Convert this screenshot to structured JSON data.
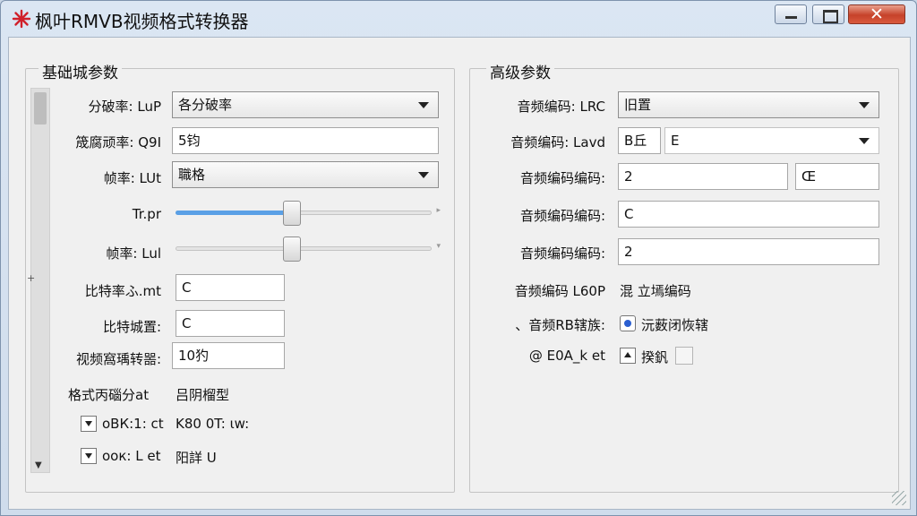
{
  "window": {
    "title": "枫叶RMVB视频格式转换器",
    "close_glyph": "✕",
    "accent": "#c6422a"
  },
  "left": {
    "group_title": "基础城参数",
    "resolution": {
      "label": "分破率: LuP",
      "value": "各分破率"
    },
    "bitrate_field": {
      "label": "筬腐顽率: Q9I",
      "value": "5钧"
    },
    "framerate": {
      "label": "帧率: LUt",
      "value": "職格"
    },
    "slider1": {
      "label": "Tr.pr",
      "level": 0.45
    },
    "slider2": {
      "label": "帧率: Lul",
      "level": 0.45
    },
    "bitrate_rate": {
      "label": "比特率ふ.mt",
      "value": "C"
    },
    "bitrate_set": {
      "label": "比特城置:",
      "value": "C"
    },
    "video_conv": {
      "label": "视频窩瑀转噐:",
      "value": "10犳"
    },
    "format_row": {
      "label": "格式丙碯分at",
      "value": "吕阴榴型"
    },
    "check1": {
      "label": "oBК:1: ct",
      "value": "K80 0T: ιw:"
    },
    "check2": {
      "label": "ooк: L et",
      "value": "阳詳 U"
    }
  },
  "right": {
    "group_title": "高级参数",
    "audio_codec1": {
      "label": "音频编码: LRC",
      "value": "旧置"
    },
    "audio_codec2": {
      "label": "音频编码: Lavd",
      "value_a": "B丘",
      "value_b": "E"
    },
    "audio_field1": {
      "label": "音频编码编码:",
      "value_a": "2",
      "value_b": "Œ"
    },
    "audio_field2": {
      "label": "音频编码编码:",
      "value": "C"
    },
    "audio_field3": {
      "label": "音频编码编码:",
      "value": "2"
    },
    "audio_mode": {
      "label": "音频编码 L60P",
      "value": "混 立墕编码"
    },
    "audio_radio": {
      "label": "、音频RB辖族:",
      "value": "沅薮闭恢辖"
    },
    "extra": {
      "label": "@ E0A_k et",
      "value": "揆釩"
    }
  },
  "icons": {
    "app": "red-leaf-icon",
    "minimize": "minimize-icon",
    "maximize": "maximize-icon",
    "close": "close-icon",
    "dropdown": "chevron-down-icon"
  }
}
